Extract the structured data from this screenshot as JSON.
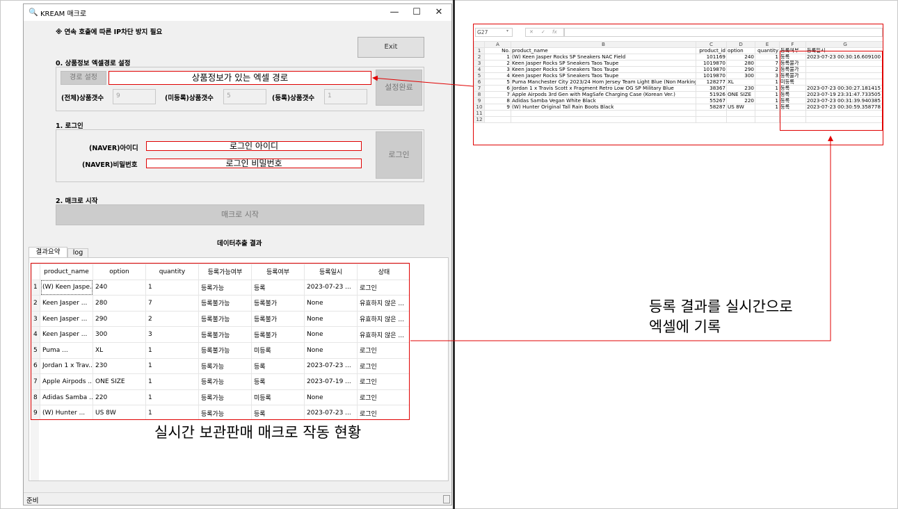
{
  "window": {
    "title": "KREAM 매크로",
    "controls": {
      "minimize": "—",
      "maximize": "☐",
      "close": "✕"
    },
    "notice": "※ 연속 호출에 따른 IP차단 방지 필요",
    "exit_label": "Exit",
    "section0": {
      "heading": "0. 상품정보 엑셀경로 설정",
      "path_button": "경로 설정",
      "path_value": "상품정보가 있는 엑셀 경로",
      "confirm_button": "설정완료",
      "total_label": "(전체)상품갯수",
      "total_value": "9",
      "unreg_label": "(미등록)상품갯수",
      "unreg_value": "5",
      "reg_label": "(등록)상품갯수",
      "reg_value": "1"
    },
    "section1": {
      "heading": "1. 로그인",
      "id_label": "(NAVER)아이디",
      "id_value": "로그인 아이디",
      "pw_label": "(NAVER)비밀번호",
      "pw_value": "로그인 비밀번호",
      "login_button": "로그인"
    },
    "section2": {
      "heading": "2. 매크로 시작",
      "start_button": "매크로 시작"
    },
    "results_title": "데이터추출 결과",
    "tabs": [
      "결과요약",
      "log"
    ],
    "status_bar": "준비",
    "table": {
      "columns": [
        "product_name",
        "option",
        "quantity",
        "등록가능여부",
        "등록여부",
        "등록일시",
        "상태"
      ],
      "rows": [
        [
          "1",
          "(W) Keen Jaspe...",
          "240",
          "1",
          "등록가능",
          "등록",
          "2023-07-23 ...",
          "로그인"
        ],
        [
          "2",
          "Keen Jasper ...",
          "280",
          "7",
          "등록불가능",
          "등록불가",
          "None",
          "유효하지 않은 ..."
        ],
        [
          "3",
          "Keen Jasper ...",
          "290",
          "2",
          "등록불가능",
          "등록불가",
          "None",
          "유효하지 않은 ..."
        ],
        [
          "4",
          "Keen Jasper ...",
          "300",
          "3",
          "등록불가능",
          "등록불가",
          "None",
          "유효하지 않은 ..."
        ],
        [
          "5",
          "Puma ...",
          "XL",
          "1",
          "등록불가능",
          "미등록",
          "None",
          "로그인"
        ],
        [
          "6",
          "Jordan 1 x Trav...",
          "230",
          "1",
          "등록가능",
          "등록",
          "2023-07-23 ...",
          "로그인"
        ],
        [
          "7",
          "Apple Airpods ...",
          "ONE SIZE",
          "1",
          "등록가능",
          "등록",
          "2023-07-19 ...",
          "로그인"
        ],
        [
          "8",
          "Adidas Samba ...",
          "220",
          "1",
          "등록가능",
          "미등록",
          "None",
          "로그인"
        ],
        [
          "9",
          "(W) Hunter ...",
          "US 8W",
          "1",
          "등록가능",
          "등록",
          "2023-07-23 ...",
          "로그인"
        ]
      ]
    }
  },
  "excel": {
    "cell_ref": "G27",
    "formula_icons": [
      "✕",
      "✓",
      "fx"
    ],
    "col_headers": [
      "",
      "A",
      "B",
      "C",
      "D",
      "E",
      "F",
      "G"
    ],
    "header_row": [
      "1",
      "No.",
      "product_name",
      "product_id",
      "option",
      "quantity",
      "등록여부",
      "등록일시"
    ],
    "rows": [
      [
        "2",
        "1",
        "(W) Keen Jasper Rocks SP Sneakers NAC Field",
        "101169",
        "240",
        "1",
        "등록",
        "2023-07-23 00:30:16.609100"
      ],
      [
        "3",
        "2",
        "Keen Jasper Rocks SP Sneakers Taos Taupe",
        "1019870",
        "280",
        "7",
        "등록불가",
        ""
      ],
      [
        "4",
        "3",
        "Keen Jasper Rocks SP Sneakers Taos Taupe",
        "1019870",
        "290",
        "2",
        "등록불가",
        ""
      ],
      [
        "5",
        "4",
        "Keen Jasper Rocks SP Sneakers Taos Taupe",
        "1019870",
        "300",
        "3",
        "등록불가",
        ""
      ],
      [
        "6",
        "5",
        "Puma Manchester City 2023/24 Hom Jersey Team Light Blue (Non Marking)",
        "128277",
        "XL",
        "1",
        "미등록",
        ""
      ],
      [
        "7",
        "6",
        "Jordan 1 x Travis Scott x Fragment Retro Low OG SP Military Blue",
        "38367",
        "230",
        "1",
        "등록",
        "2023-07-23 00:30:27.181415"
      ],
      [
        "8",
        "7",
        "Apple Airpods 3rd Gen with MagSafe Charging Case (Korean Ver.)",
        "51926",
        "ONE SIZE",
        "1",
        "등록",
        "2023-07-19 23:31:47.733505"
      ],
      [
        "9",
        "8",
        "Adidas Samba Vegan White Black",
        "55267",
        "220",
        "1",
        "등록",
        "2023-07-23 00:31:39.940385"
      ],
      [
        "10",
        "9",
        "(W) Hunter Original Tall Rain Boots Black",
        "58287",
        "US 8W",
        "1",
        "등록",
        "2023-07-23 00:30:59.358778"
      ],
      [
        "11",
        "",
        "",
        "",
        "",
        "",
        "",
        ""
      ],
      [
        "12",
        "",
        "",
        "",
        "",
        "",
        "",
        ""
      ]
    ]
  },
  "annotations": {
    "realtime_status": "실시간 보관판매 매크로 작동 현황",
    "excel_record_line1": "등록 결과를 실시간으로",
    "excel_record_line2": "엑셀에 기록"
  },
  "colors": {
    "annotation_red": "#e00000",
    "window_bg": "#f0f0f0"
  }
}
